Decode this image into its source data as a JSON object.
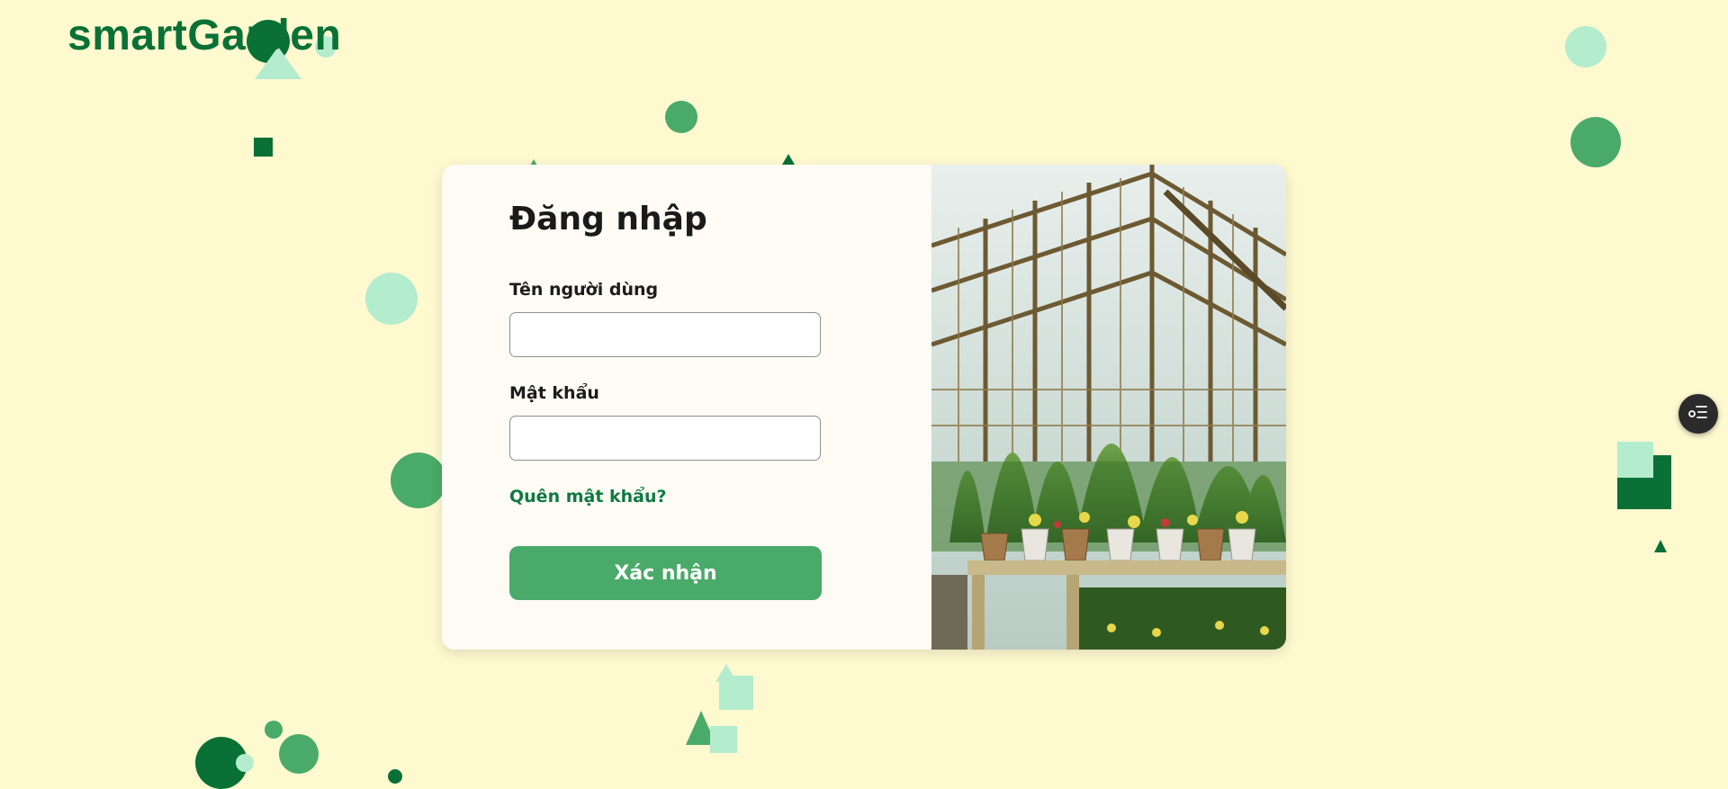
{
  "brand": {
    "logo_text": "smartGarden"
  },
  "login": {
    "title": "Đăng nhập",
    "username_label": "Tên người dùng",
    "username_value": "",
    "password_label": "Mật khẩu",
    "password_value": "",
    "forgot_password": "Quên mật khẩu?",
    "submit_label": "Xác nhận"
  },
  "floating_button": {
    "icon": "list-settings-icon"
  },
  "colors": {
    "background": "#fff9d0",
    "brand_green": "#0a7136",
    "button_green": "#4aaa69",
    "link_green": "#0e7a43",
    "deco_light": "#b4ecce",
    "deco_mid": "#4aaa69",
    "deco_dark": "#0a7136"
  }
}
